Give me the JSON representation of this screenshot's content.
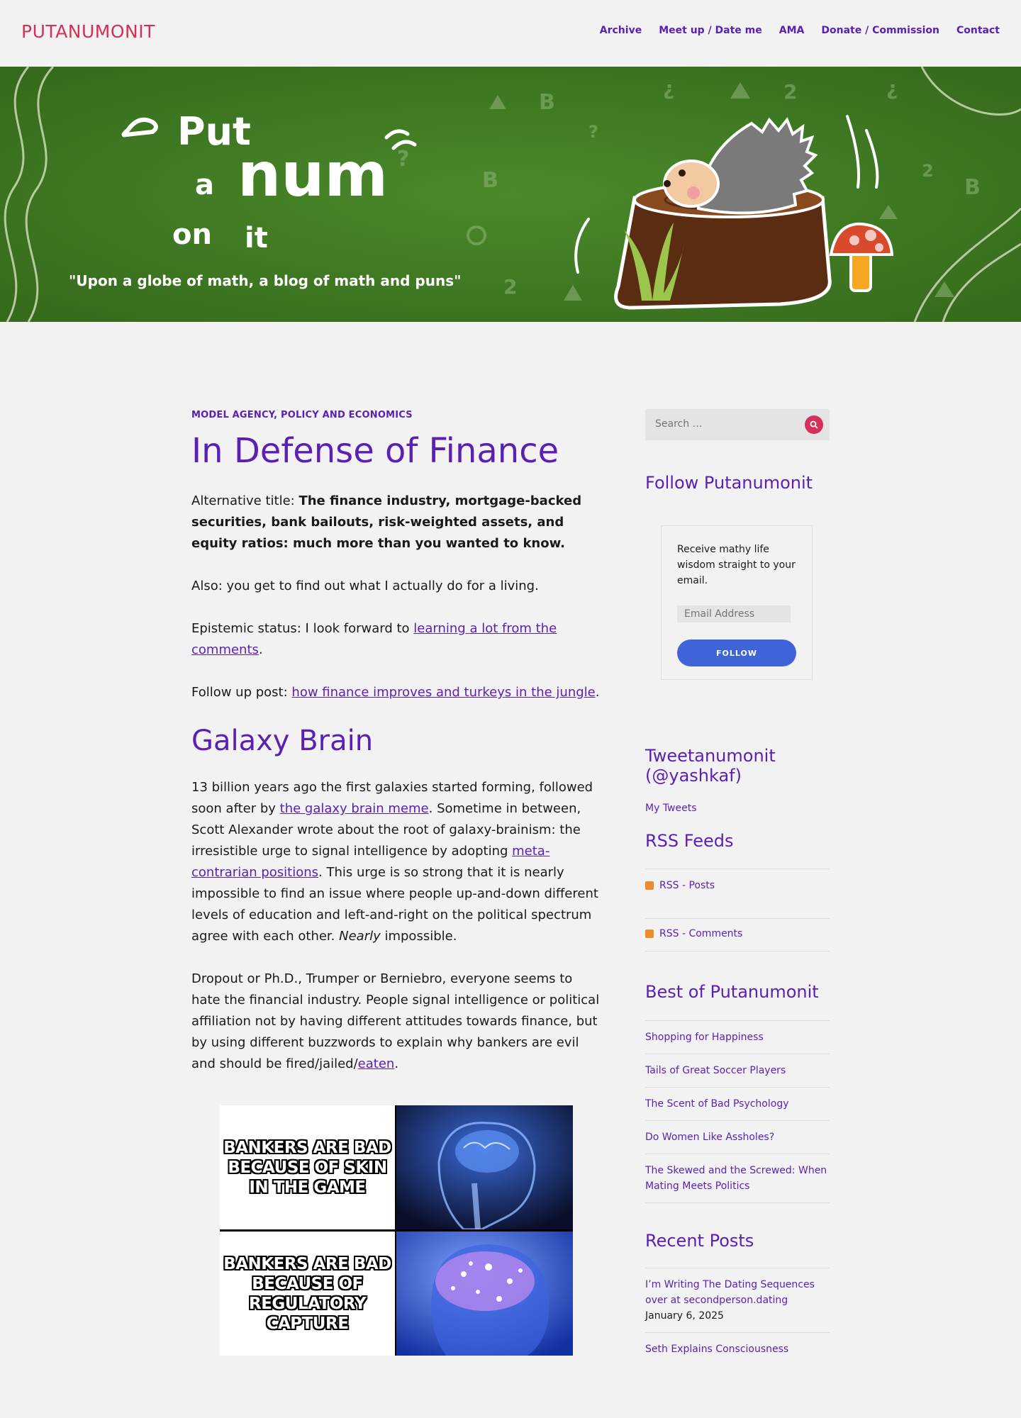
{
  "site": {
    "title": "PUTANUMONIT",
    "nav": [
      "Archive",
      "Meet up / Date me",
      "AMA",
      "Donate / Commission",
      "Contact"
    ]
  },
  "banner": {
    "logo_line1": "Put",
    "logo_line2": "a num",
    "logo_line3": "on it",
    "tagline": "\"Upon a globe of math, a blog of math and puns\""
  },
  "post": {
    "category": "MODEL AGENCY, POLICY AND ECONOMICS",
    "title": "In Defense of Finance",
    "alt_title_label": "Alternative title: ",
    "alt_title_bold": "The finance industry, mortgage-backed securities, bank bailouts, risk-weighted assets, and equity ratios: much more than you wanted to know.",
    "also": "Also: you get to find out what I actually do for a living.",
    "epistemic_label": "Epistemic status: I look forward to ",
    "epistemic_link": "learning a lot from the comments",
    "followup_label": "Follow up post: ",
    "followup_link": "how finance improves and turkeys in the jungle",
    "section_heading": "Galaxy Brain",
    "p1_a": "13 billion years ago the first galaxies started forming, followed soon after by ",
    "p1_link1": "the galaxy brain meme",
    "p1_b": ". Sometime in between, Scott Alexander wrote about the root of galaxy-brainism: the irresistible urge to signal intelligence by adopting ",
    "p1_link2": "meta-contrarian positions",
    "p1_c": ". This urge is so strong that it is nearly impossible to find an issue where people up-and-down different levels of education and left-and-right on the political spectrum agree with each other. ",
    "p1_italic": "Nearly",
    "p1_d": " impossible.",
    "p2": "Dropout or Ph.D., Trumper or Berniebro, everyone seems to hate the financial industry. People signal intelligence or political affiliation not by having different attitudes towards finance, but by using different buzzwords to explain why bankers are evil and should be fired/jailed/",
    "p2_link": "eaten",
    "meme_top": "BANKERS ARE BAD BECAUSE OF SKIN IN THE GAME",
    "meme_bottom": "BANKERS ARE BAD BECAUSE OF REGULATORY CAPTURE"
  },
  "sidebar": {
    "search_placeholder": "Search …",
    "follow_title": "Follow Putanumonit",
    "follow_text": "Receive mathy life wisdom straight to your email.",
    "email_placeholder": "Email Address",
    "follow_button": "FOLLOW",
    "tweets_title": "Tweetanumonit (@yashkaf)",
    "my_tweets": "My Tweets",
    "rss_title": "RSS Feeds",
    "rss_posts": "RSS - Posts",
    "rss_comments": "RSS - Comments",
    "best_title": "Best of Putanumonit",
    "best": [
      "Shopping for Happiness",
      "Tails of Great Soccer Players",
      "The Scent of Bad Psychology",
      "Do Women Like Assholes?",
      "The Skewed and the Screwed: When Mating Meets Politics"
    ],
    "recent_title": "Recent Posts",
    "recent": [
      {
        "title": "I’m Writing The Dating Sequences over at secondperson.dating",
        "date": "January 6, 2025"
      },
      {
        "title": "Seth Explains Consciousness",
        "date": ""
      }
    ]
  },
  "colors": {
    "accent": "#5a1fb3",
    "brand": "#d4305a",
    "banner_green": "#3f7a22",
    "follow_button": "#3f63d9"
  }
}
